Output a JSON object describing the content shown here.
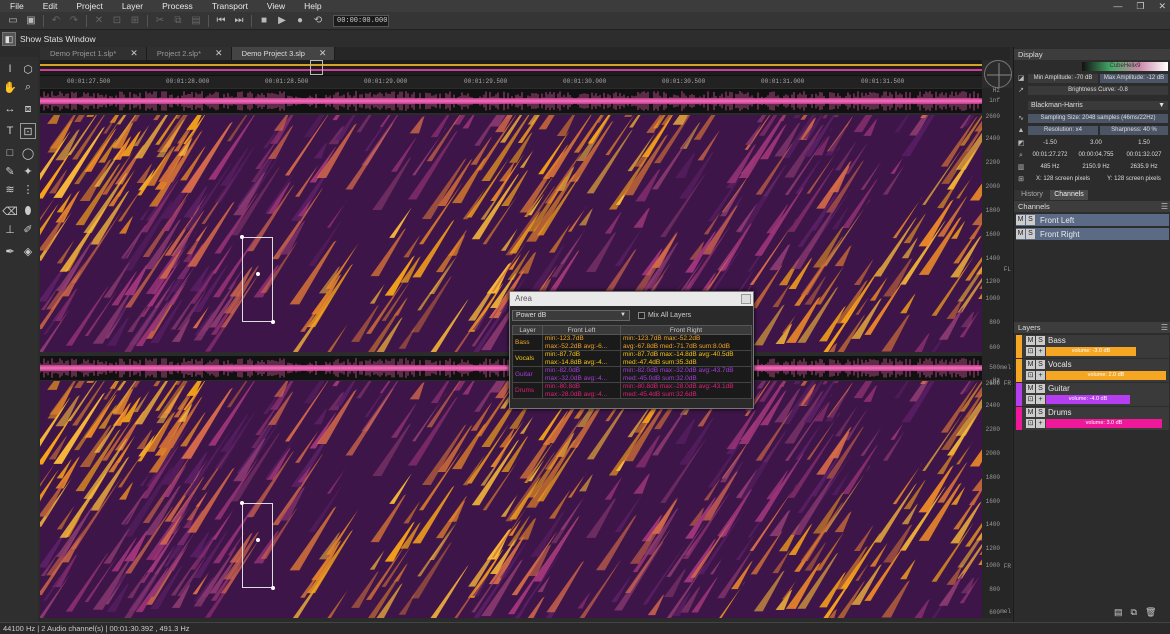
{
  "menu": {
    "items": [
      "File",
      "Edit",
      "Project",
      "Layer",
      "Process",
      "Transport",
      "View",
      "Help"
    ]
  },
  "window": {
    "minimize": "—",
    "maximize": "❐",
    "close": "✕"
  },
  "toolbar": {
    "timecode": "00:00:00.000"
  },
  "stats_button": {
    "label": "Show Stats Window"
  },
  "tabs": [
    {
      "label": "Demo Project 1.slp*",
      "active": false
    },
    {
      "label": "Project 2.slp*",
      "active": false
    },
    {
      "label": "Demo Project 3.slp",
      "active": true
    }
  ],
  "ruler": {
    "ticks": [
      "00:01:27.500",
      "00:01:28.000",
      "00:01:28.500",
      "00:01:29.000",
      "00:01:29.500",
      "00:01:30.000",
      "00:01:30.500",
      "00:01:31.000",
      "00:01:31.500"
    ]
  },
  "freq_scale": {
    "labels": [
      "2600",
      "2400",
      "2200",
      "2000",
      "1800",
      "1600",
      "1400",
      "1200",
      "1000",
      "800",
      "600",
      "500"
    ],
    "top_label": "Hz",
    "bottom_label": "mel",
    "wave_label": "inf",
    "channel_tags": [
      "FL",
      "FR"
    ]
  },
  "area_dialog": {
    "title": "Area",
    "mode": "Power dB",
    "mix_label": "Mix All Layers",
    "headers": [
      "Layer",
      "Front Left",
      "Front Right"
    ],
    "rows": [
      {
        "layer": "Bass",
        "color": "#f5a623",
        "fl1": "min:-123.7dB",
        "fl2": "max:-52.2dB avg:-6...",
        "fr1": "min:-123.7dB max:-52.2dB",
        "fr2": "avg:-67.8dB med:-71.7dB sum:8.0dB"
      },
      {
        "layer": "Vocals",
        "color": "#f5c518",
        "fl1": "min:-87.7dB",
        "fl2": "max:-14.8dB avg:-4...",
        "fr1": "min:-87.7dB max:-14.8dB avg:-40.5dB",
        "fr2": "med:-47.4dB sum:35.3dB"
      },
      {
        "layer": "Guitar",
        "color": "#a63ce0",
        "fl1": "min:-82.0dB",
        "fl2": "max:-32.0dB avg:-4...",
        "fr1": "min:-82.0dB max:-32.0dB avg:-43.7dB",
        "fr2": "med:-45.0dB sum:32.0dB"
      },
      {
        "layer": "Drums",
        "color": "#e0207a",
        "fl1": "min:-80.8dB",
        "fl2": "max:-28.0dB avg:-4...",
        "fr1": "min:-80.8dB max:-28.0dB avg:-43.1dB",
        "fr2": "med:-45.4dB sum:32.6dB"
      }
    ]
  },
  "display_panel": {
    "title": "Display",
    "colormap": "CubeHelix9",
    "min_amplitude": "Min Amplitude: -70 dB",
    "max_amplitude": "Max Amplitude: -12 dB",
    "brightness": "Brightness Curve: -0.8",
    "window_fn": "Blackman-Harris",
    "sampling": "Sampling Size: 2048 samples (46ms/22Hz)",
    "resolution": "Resolution: x4",
    "sharpness": "Sharpness: 40 %",
    "v1": "-1.50",
    "v2": "3.00",
    "v3": "1.50",
    "t1": "00:01:27.272",
    "t2": "00:00:04.755",
    "t3": "00:01:32.027",
    "f1": "485 Hz",
    "f2": "2150.9 Hz",
    "f3": "2635.9 Hz",
    "x_px": "X: 128 screen pixels",
    "y_px": "Y: 128 screen pixels"
  },
  "panel_tabs": [
    "History",
    "Channels"
  ],
  "channels": {
    "title": "Channels",
    "items": [
      "Front Left",
      "Front Right"
    ]
  },
  "layers": {
    "title": "Layers",
    "items": [
      {
        "name": "Bass",
        "volume": "volume: -3.0 dB",
        "color": "#f5a623",
        "fill": 0.75
      },
      {
        "name": "Vocals",
        "volume": "volume: 2.0 dB",
        "color": "#f5a623",
        "fill": 1.0
      },
      {
        "name": "Guitar",
        "volume": "volume: -4.0 dB",
        "color": "#b43ef0",
        "fill": 0.7
      },
      {
        "name": "Drums",
        "volume": "volume: 3.0 dB",
        "color": "#f0189a",
        "fill": 0.97
      }
    ]
  },
  "status_bar": "44100 Hz | 2 Audio channel(s) | 00:01:30.392 , 491.3 Hz"
}
